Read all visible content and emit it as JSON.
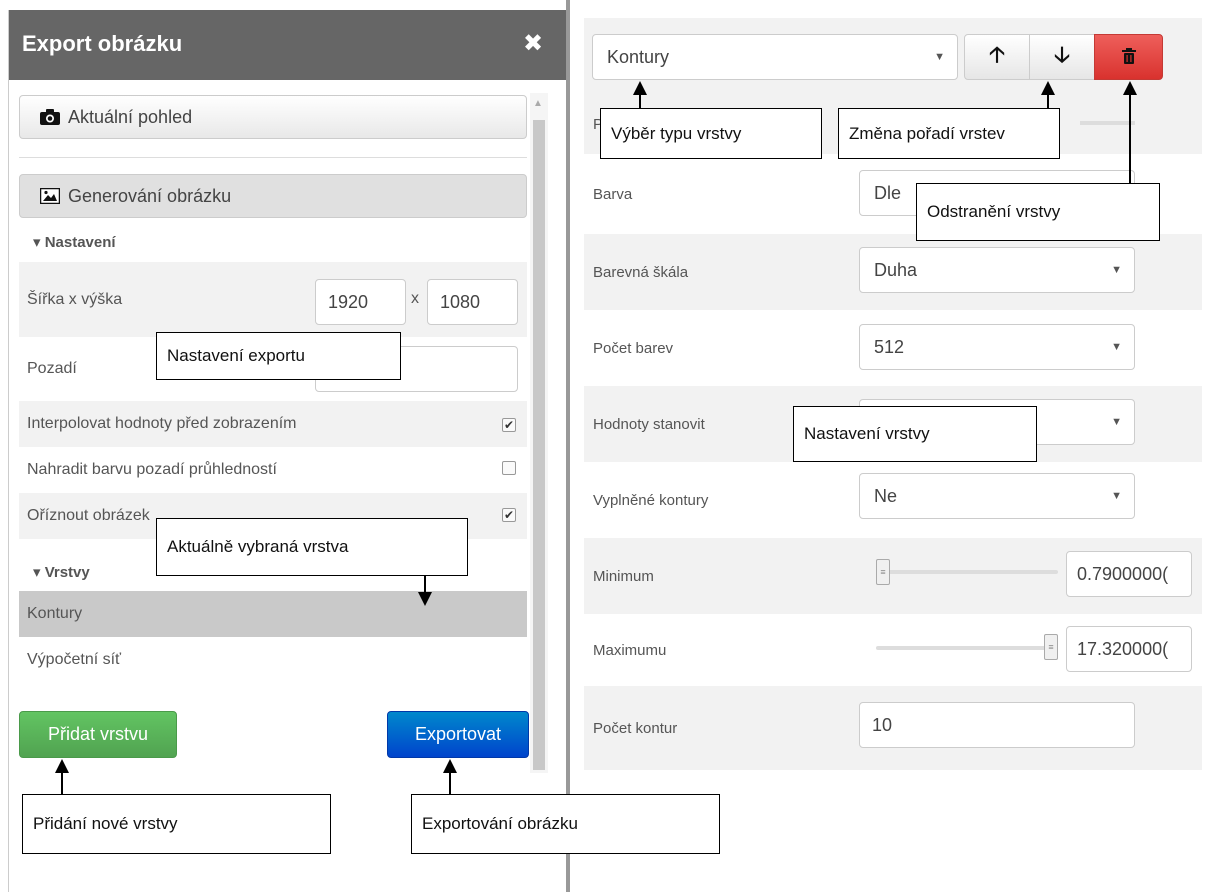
{
  "left_panel": {
    "title": "Export obrázku",
    "close_glyph": "✖",
    "tab_current_view": "Aktuální pohled",
    "tab_generate": "Generování obrázku",
    "settings_title": "▾ Nastavení",
    "size_label": "Šířka x výška",
    "width_value": "1920",
    "size_sep": "x",
    "height_value": "1080",
    "background_label": "Pozadí",
    "interpolate_label": "Interpolovat hodnoty před zobrazením",
    "replace_bg_label": "Nahradit barvu pozadí průhledností",
    "crop_label": "Oříznout obrázek",
    "layers_title": "▾ Vrstvy",
    "layers": [
      "Kontury",
      "Výpočetní síť"
    ],
    "add_layer_button": "Přidat vrstvu",
    "export_button": "Exportovat",
    "checkbox_states": {
      "interpolate": true,
      "replace_bg": false,
      "crop": true
    }
  },
  "right_panel": {
    "layer_type_value": "Kontury",
    "color_label": "Barva",
    "color_value": "Dle",
    "color_scale_label": "Barevná škála",
    "color_scale_value": "Duha",
    "color_count_label": "Počet barev",
    "color_count_value": "512",
    "values_label": "Hodnoty stanovit",
    "filled_label": "Vyplněné kontury",
    "filled_value": "Ne",
    "minimum_label": "Minimum",
    "minimum_value": "0.7900000(",
    "maximum_label": "Maximumu",
    "maximum_value": "17.320000(",
    "contour_count_label": "Počet kontur",
    "contour_count_value": "10",
    "hidden_row_label_initial": "P"
  },
  "annotations": {
    "layer_type": "Výběr typu vrstvy",
    "order": "Změna pořadí vrstev",
    "remove": "Odstranění vrstvy",
    "export_settings": "Nastavení exportu",
    "layer_settings": "Nastavení vrstvy",
    "selected_layer": "Aktuálně vybraná vrstva",
    "add_layer": "Přidání nové vrstvy",
    "export_image": "Exportování obrázku"
  },
  "icons": {
    "camera": "camera-icon",
    "image": "image-icon",
    "up": "arrow-up-icon",
    "down": "arrow-down-icon",
    "trash": "trash-icon"
  },
  "colors": {
    "header": "#666666",
    "green": "#51a351",
    "blue": "#0044cc",
    "red": "#d9322e",
    "selected_row": "#c9c9c9"
  }
}
